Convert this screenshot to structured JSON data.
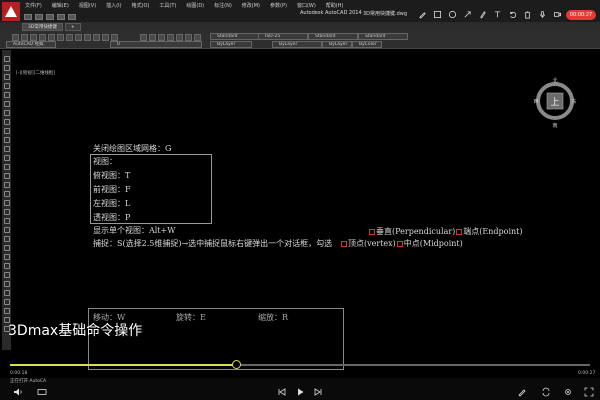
{
  "app": {
    "title": "Autodesk AutoCAD 2014",
    "filename": "3D常用快捷键.dwg",
    "menu": [
      "文件(F)",
      "编辑(E)",
      "视图(V)",
      "插入(I)",
      "格式(O)",
      "工具(T)",
      "绘图(D)",
      "标注(N)",
      "修改(M)",
      "参数(P)",
      "窗口(W)",
      "帮助(H)"
    ],
    "file_tabs": [
      "3D常用快捷键",
      "+"
    ]
  },
  "toolbar": {
    "workspace": "AutoCAD 经典",
    "layer_value": "0",
    "styles": [
      "Standard",
      "ISO-25",
      "Standard",
      "Standard"
    ],
    "color_value": "ByLayer",
    "linetype_value": "ByLayer",
    "lineweight_value": "ByLayer",
    "plotstyle_value": "ByColor"
  },
  "canvas": {
    "view_label": "[-][俯视][二维线框]",
    "line1": "关闭绘图区域网格：G",
    "views_title": "视图：",
    "views": [
      "俯视图：T",
      "前视图：F",
      "左视图：L",
      "透视图：P"
    ],
    "single_view": "显示单个视图：Alt+W",
    "capture": "捕捉：S(选择2.5维捕捉)→选中捕捉鼠标右键弹出一个对话框，勾选",
    "snap_row1_a": "垂直(Perpendicular)",
    "snap_row1_b": "端点(Endpoint)",
    "snap_row2_a": "顶点(vertex)",
    "snap_row2_b": "中点(Midpoint)",
    "bottom_items": [
      "移动：W",
      "旋转：E",
      "缩放：R"
    ]
  },
  "viewcube": {
    "north": "北",
    "south": "南",
    "west": "西",
    "east": "东",
    "face": "上"
  },
  "overlay": {
    "subtitle": "3Dmax基础命令操作",
    "timer": "00:00:27"
  },
  "player": {
    "elapsed": "0:00:18",
    "duration": "0:00:27",
    "progress": 0.39,
    "command_line": "键入命令",
    "status": "正在打开 AutoCA"
  },
  "colors": {
    "accent": "#d6e04a",
    "record": "#e53935",
    "brand": "#b52020"
  }
}
